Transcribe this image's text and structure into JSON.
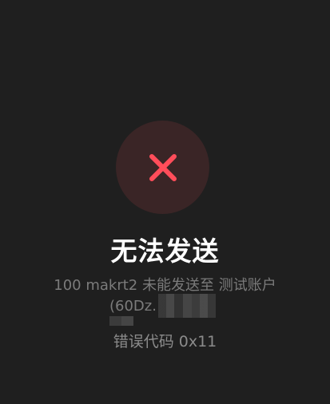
{
  "dialog": {
    "icon": "close-icon",
    "status_color": "#ff4d5a",
    "title": "无法发送",
    "message_line1": "100 makrt2 未能发送至 测试账户",
    "recipient_prefix": "(60Dz.",
    "error_code": "错误代码 0x11"
  }
}
